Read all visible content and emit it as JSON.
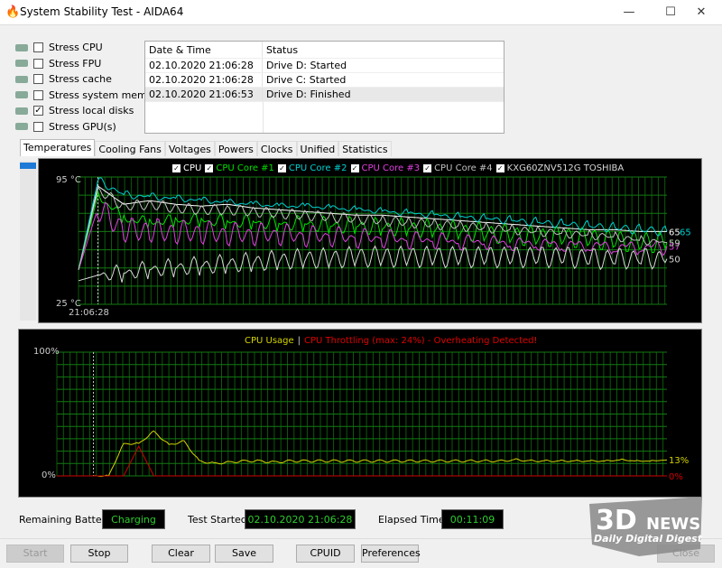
{
  "window": {
    "title": "System Stability Test - AIDA64",
    "minimize": "—",
    "maximize": "☐",
    "close": "✕"
  },
  "stress_options": [
    {
      "label": "Stress CPU",
      "checked": false,
      "icon": "cpu-icon"
    },
    {
      "label": "Stress FPU",
      "checked": false,
      "icon": "fpu-icon"
    },
    {
      "label": "Stress cache",
      "checked": false,
      "icon": "cache-icon"
    },
    {
      "label": "Stress system memory",
      "checked": false,
      "icon": "memory-icon"
    },
    {
      "label": "Stress local disks",
      "checked": true,
      "icon": "disk-icon"
    },
    {
      "label": "Stress GPU(s)",
      "checked": false,
      "icon": "gpu-icon"
    }
  ],
  "log": {
    "headers": [
      "Date & Time",
      "Status"
    ],
    "rows": [
      [
        "02.10.2020 21:06:28",
        "Drive D: Started"
      ],
      [
        "02.10.2020 21:06:28",
        "Drive C: Started"
      ],
      [
        "02.10.2020 21:06:53",
        "Drive D: Finished"
      ]
    ]
  },
  "tabs": [
    "Temperatures",
    "Cooling Fans",
    "Voltages",
    "Powers",
    "Clocks",
    "Unified",
    "Statistics"
  ],
  "active_tab": "Temperatures",
  "chart_data": [
    {
      "type": "line",
      "title": "",
      "ylim": [
        25,
        95
      ],
      "ytick_labels": [
        "95 °C",
        "25 °C"
      ],
      "x_start_label": "21:06:28",
      "grid": true,
      "series": [
        {
          "name": "CPU",
          "color": "#ffffff",
          "values": [
            44,
            90,
            80,
            82,
            80,
            79,
            80,
            78,
            77,
            76,
            75,
            74,
            74,
            73,
            72,
            71,
            70,
            69,
            68,
            67,
            66,
            66,
            65,
            65
          ],
          "end_label": "65"
        },
        {
          "name": "CPU Core #1",
          "color": "#00e000",
          "values": [
            44,
            85,
            72,
            70,
            71,
            71,
            70,
            70,
            69,
            69,
            68,
            68,
            67,
            67,
            66,
            65,
            64,
            63,
            62,
            62,
            61,
            60,
            59,
            59
          ],
          "end_label": "59"
        },
        {
          "name": "CPU Core #2",
          "color": "#00d0d0",
          "values": [
            44,
            93,
            85,
            84,
            83,
            82,
            81,
            80,
            79,
            79,
            78,
            77,
            76,
            75,
            74,
            73,
            72,
            71,
            70,
            69,
            68,
            67,
            66,
            65
          ],
          "end_label": "65"
        },
        {
          "name": "CPU Core #3",
          "color": "#e040e0",
          "values": [
            44,
            78,
            66,
            66,
            65,
            65,
            64,
            64,
            64,
            63,
            63,
            62,
            62,
            61,
            61,
            60,
            60,
            59,
            59,
            58,
            58,
            57,
            57,
            57
          ],
          "end_label": "57"
        },
        {
          "name": "CPU Core #4",
          "color": "#c0c0c0",
          "values": [
            44,
            88,
            79,
            80,
            78,
            77,
            77,
            76,
            75,
            74,
            73,
            72,
            71,
            70,
            69,
            68,
            67,
            66,
            65,
            64,
            63,
            62,
            60,
            59
          ],
          "end_label": "59"
        },
        {
          "name": "KXG60ZNV512G TOSHIBA",
          "color": "#d8d8d8",
          "values": [
            38,
            41,
            42,
            44,
            45,
            46,
            47,
            48,
            49,
            50,
            50,
            51,
            51,
            51,
            51,
            51,
            51,
            51,
            51,
            51,
            50,
            50,
            50,
            50
          ],
          "end_label": "50"
        }
      ]
    },
    {
      "type": "line",
      "title": "",
      "ylim": [
        0,
        100
      ],
      "ytick_labels": [
        "100%",
        "0%"
      ],
      "grid": true,
      "legend": {
        "usage": "CPU Usage",
        "sep": "|",
        "throttle": "CPU Throttling (max: 24%) - Overheating Detected!"
      },
      "series": [
        {
          "name": "CPU Usage",
          "color": "#d4d400",
          "values": [
            0,
            0,
            0,
            26,
            26,
            36,
            25,
            28,
            12,
            10,
            11,
            12,
            12,
            11,
            12,
            12,
            12,
            12,
            12,
            12,
            12,
            12,
            12,
            12,
            12,
            12,
            12,
            12,
            12,
            13,
            12,
            12,
            12,
            12,
            12,
            12,
            13,
            12,
            12,
            13
          ],
          "end_label": "13%"
        },
        {
          "name": "CPU Throttling",
          "color": "#d00000",
          "values": [
            0,
            0,
            0,
            0,
            24,
            0,
            0,
            0,
            0,
            0,
            0,
            0,
            0,
            0,
            0,
            0,
            0,
            0,
            0,
            0,
            0,
            0,
            0,
            0,
            0,
            0,
            0,
            0,
            0,
            0,
            0,
            0,
            0,
            0,
            0,
            0,
            0,
            0,
            0,
            0
          ],
          "end_label": "0%"
        }
      ]
    }
  ],
  "status": {
    "battery_label": "Remaining Battery:",
    "battery_value": "Charging",
    "started_label": "Test Started:",
    "started_value": "02.10.2020 21:06:28",
    "elapsed_label": "Elapsed Time:",
    "elapsed_value": "00:11:09"
  },
  "buttons": {
    "start": "Start",
    "stop": "Stop",
    "clear": "Clear",
    "save": "Save",
    "cpuid": "CPUID",
    "preferences": "Preferences",
    "close": "Close"
  },
  "watermark": {
    "logo": "3DNEWS",
    "tagline": "Daily Digital Digest"
  }
}
